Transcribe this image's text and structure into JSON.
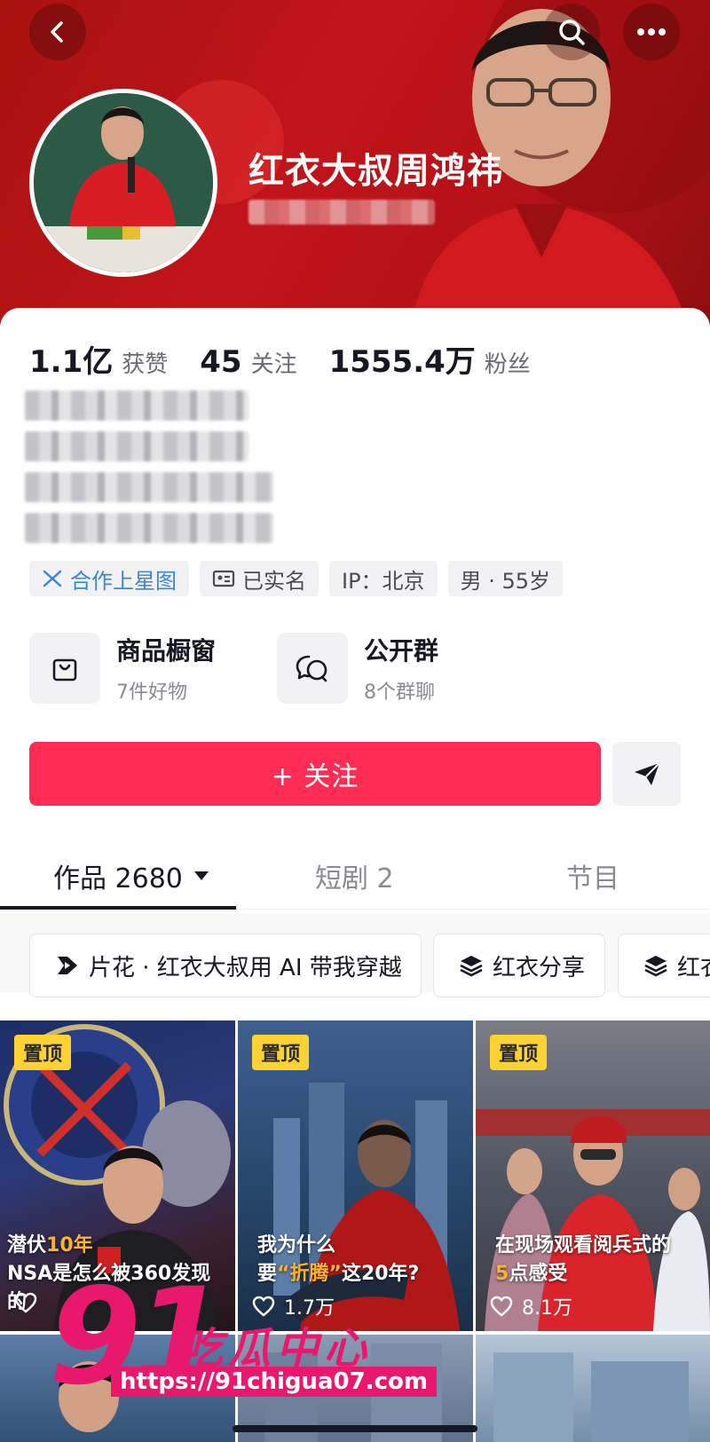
{
  "profile": {
    "nickname": "红衣大叔周鸿祎",
    "stats": {
      "likes_value": "1.1亿",
      "likes_label": "获赞",
      "following_value": "45",
      "following_label": "关注",
      "followers_value": "1555.4万",
      "followers_label": "粉丝"
    },
    "tags": {
      "cooperation": "合作上星图",
      "verified": "已实名",
      "ip": "IP：北京",
      "gender_age": "男 · 55岁"
    }
  },
  "services": {
    "shop": {
      "title": "商品橱窗",
      "subtitle": "7件好物"
    },
    "group": {
      "title": "公开群",
      "subtitle": "8个群聊"
    }
  },
  "actions": {
    "follow_label": "+ 关注"
  },
  "tabs": {
    "works": "作品 2680",
    "drama": "短剧 2",
    "program": "节目"
  },
  "collections": [
    "片花 · 红衣大叔用 AI 带我穿越",
    "红衣分享",
    "红衣"
  ],
  "videos": [
    {
      "pinned": "置顶",
      "caption_prefix": "潜伏",
      "caption_highlight": "10年",
      "caption_line2": "NSA是怎么被360发现的",
      "likes": ""
    },
    {
      "pinned": "置顶",
      "caption_line1": "我为什么",
      "caption_prefix": "要",
      "caption_highlight": "“折腾”",
      "caption_suffix": "这20年?",
      "likes": "1.7万"
    },
    {
      "pinned": "置顶",
      "caption_line1": "在现场观看阅兵式的",
      "caption_highlight": "5",
      "caption_suffix": "点感受",
      "likes": "8.1万"
    }
  ],
  "watermark": {
    "brand_number": "91",
    "brand_name": "吃瓜中心",
    "url": "https://91chigua07.com"
  },
  "colors": {
    "primary_red": "#fe2c55",
    "cover_red": "#c0141a",
    "pin_yellow": "#fcd232",
    "link_blue": "#3a86d8"
  },
  "icons": [
    "back-icon",
    "search-icon",
    "more-icon",
    "star-map-icon",
    "id-card-icon",
    "shopping-bag-icon",
    "group-chat-icon",
    "share-send-icon",
    "caret-down-icon",
    "play-collection-icon",
    "stack-icon",
    "heart-icon"
  ]
}
